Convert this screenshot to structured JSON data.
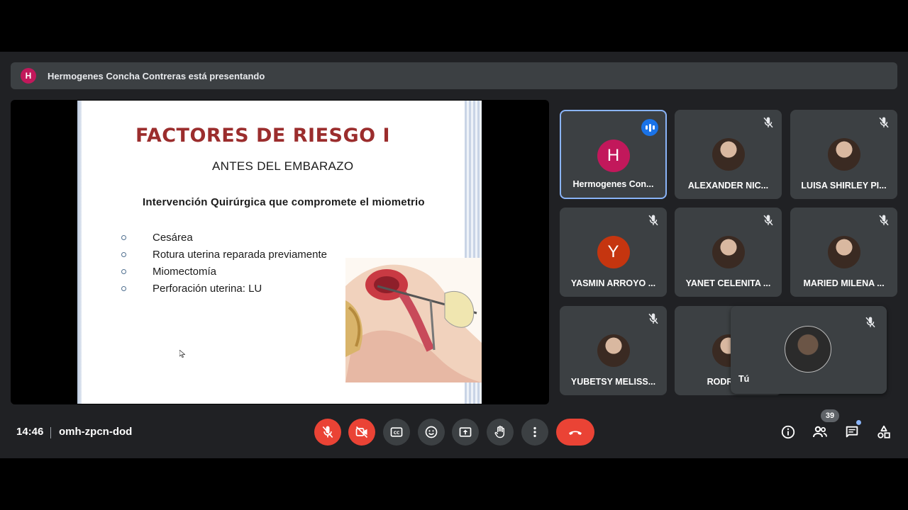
{
  "banner": {
    "avatar_initial": "H",
    "text": "Hermogenes Concha Contreras está presentando"
  },
  "slide": {
    "title": "FACTORES DE RIESGO I",
    "subtitle": "ANTES DEL EMBARAZO",
    "heading": "Intervención Quirúrgica que compromete el miometrio",
    "bullets": [
      "Cesárea",
      "Rotura uterina reparada previamente",
      "Miomectomía",
      "Perforación uterina: LU"
    ]
  },
  "participants": [
    {
      "name": "Hermogenes Con...",
      "initial": "H",
      "color": "#c2185b",
      "active": true
    },
    {
      "name": "ALEXANDER NIC...",
      "photo": true
    },
    {
      "name": "LUISA SHIRLEY PI...",
      "photo": true
    },
    {
      "name": "YASMIN ARROYO ...",
      "initial": "Y",
      "color": "#c5350f"
    },
    {
      "name": "YANET CELENITA ...",
      "photo": true
    },
    {
      "name": "MARIED MILENA ...",
      "photo": true
    },
    {
      "name": "YUBETSY MELISS...",
      "photo": true
    },
    {
      "name": "RODRIGO",
      "photo": true
    }
  ],
  "self": {
    "name": "Tú"
  },
  "bottom": {
    "time": "14:46",
    "meeting_code": "omh-zpcn-dod",
    "participant_count": "39"
  },
  "icons": {
    "mic_muted": "mic-off-icon",
    "cam_off": "videocam-off-icon",
    "captions": "closed-caption-icon",
    "emoji": "emoji-icon",
    "present": "present-to-all-icon",
    "hand": "raise-hand-icon",
    "more": "more-vert-icon",
    "end": "call-end-icon",
    "info": "info-icon",
    "people": "people-icon",
    "chat": "chat-icon",
    "activities": "activities-icon"
  },
  "colors": {
    "background": "#202124",
    "tile": "#3c4043",
    "danger": "#ea4335",
    "active_border": "#8ab4f8",
    "slide_title": "#9b2d2d"
  }
}
